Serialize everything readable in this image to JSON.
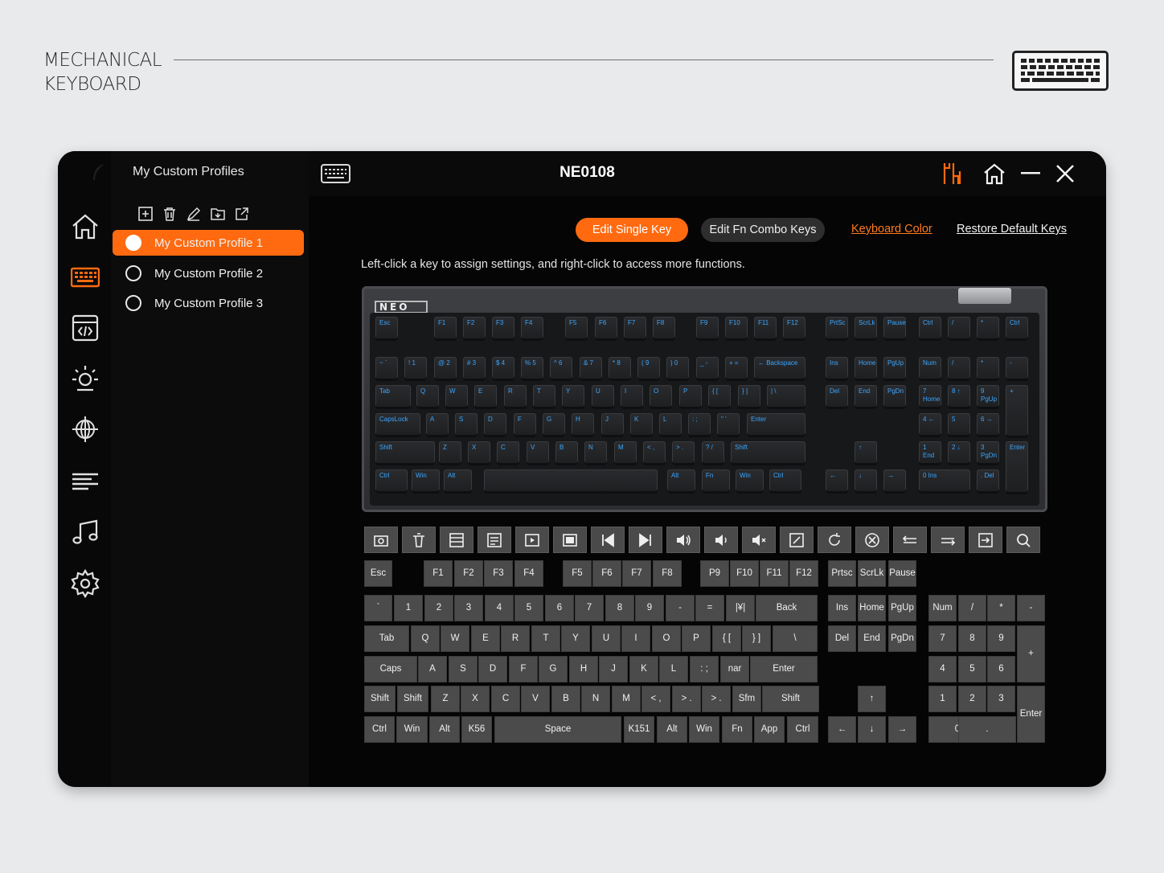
{
  "page": {
    "brand_line1": "MECHANICAL",
    "brand_line2": "KEYBOARD",
    "brand_icon": "keyboard-icon"
  },
  "app": {
    "title": "NE0108",
    "profiles_header": "My Custom Profiles",
    "accent_color": "#ff6a10",
    "window_buttons": [
      "driver-settings-icon",
      "home-icon",
      "minimize-icon",
      "close-icon"
    ]
  },
  "nav": {
    "items": [
      "home-icon",
      "keyboard-icon",
      "macro-icon",
      "lighting-icon",
      "network-icon",
      "list-icon",
      "music-icon",
      "settings-icon"
    ],
    "active": "keyboard-icon"
  },
  "profile_tools": [
    "add-icon",
    "delete-icon",
    "edit-icon",
    "import-icon",
    "export-icon"
  ],
  "profiles": [
    {
      "label": "My Custom Profile 1",
      "active": true
    },
    {
      "label": "My Custom Profile 2",
      "active": false
    },
    {
      "label": "My Custom Profile 3",
      "active": false
    }
  ],
  "toolbar": {
    "edit_single": "Edit Single Key",
    "edit_fn": "Edit Fn Combo Keys",
    "keyboard_color": "Keyboard Color",
    "restore": "Restore Default Keys"
  },
  "hint": "Left-click a key to assign settings, and right-click to access more functions.",
  "keyboard_photo": {
    "logo": "NEO",
    "rows": [
      [
        "Esc",
        "F1",
        "F2",
        "F3",
        "F4",
        "F5",
        "F6",
        "F7",
        "F8",
        "F9",
        "F10",
        "F11",
        "F12",
        "PrtSc",
        "ScrLk",
        "Pause",
        "Ctrl",
        "/",
        "*",
        "Ctrl"
      ],
      [
        "~ `",
        "! 1",
        "@ 2",
        "# 3",
        "$ 4",
        "% 5",
        "^ 6",
        "& 7",
        "* 8",
        "( 9",
        ") 0",
        "_ -",
        "+ =",
        "← Backspace",
        "Ins",
        "Home",
        "PgUp",
        "Num",
        "/",
        "*",
        "-"
      ],
      [
        "Tab",
        "Q",
        "W",
        "E",
        "R",
        "T",
        "Y",
        "U",
        "I",
        "O",
        "P",
        "{ [",
        "} ]",
        "| \\",
        "Del",
        "End",
        "PgDn",
        "7 Home",
        "8 ↑",
        "9 PgUp",
        "+"
      ],
      [
        "CapsLock",
        "A",
        "S",
        "D",
        "F",
        "G",
        "H",
        "J",
        "K",
        "L",
        ": ;",
        "\" '",
        "Enter",
        "4 ←",
        "5",
        "6 →"
      ],
      [
        "Shift",
        "Z",
        "X",
        "C",
        "V",
        "B",
        "N",
        "M",
        "< ,",
        "> .",
        "? /",
        "Shift",
        "↑",
        "1 End",
        "2 ↓",
        "3 PgDn",
        "Enter"
      ],
      [
        "Ctrl",
        "Win",
        "Alt",
        "",
        "Alt",
        "Fn",
        "Win",
        "Ctrl",
        "←",
        "↓",
        "→",
        "0 Ins",
        ". Del"
      ]
    ]
  },
  "function_buttons": [
    "screenshot-icon",
    "recycle-bin-icon",
    "calculator-icon",
    "notes-icon",
    "media-player-icon",
    "display-icon",
    "previous-track-icon",
    "next-track-icon",
    "volume-up-icon",
    "volume-down-icon",
    "mute-icon",
    "edit-box-icon",
    "refresh-icon",
    "cancel-icon",
    "tab-back-icon",
    "tab-forward-icon",
    "switch-window-icon",
    "search-icon"
  ],
  "keys": {
    "row_f": [
      "Esc",
      "F1",
      "F2",
      "F3",
      "F4",
      "F5",
      "F6",
      "F7",
      "F8",
      "P9",
      "F10",
      "F11",
      "F12",
      "Prtsc",
      "ScrLk",
      "Pause"
    ],
    "row_num": [
      "`",
      "1",
      "2",
      "3",
      "4",
      "5",
      "6",
      "7",
      "8",
      "9",
      "-",
      "=",
      "|¥|",
      "Back",
      "Ins",
      "Home",
      "PgUp",
      "Num",
      "/",
      "*",
      "-"
    ],
    "row_tab": [
      "Tab",
      "Q",
      "W",
      "E",
      "R",
      "T",
      "Y",
      "U",
      "I",
      "O",
      "P",
      "{ [",
      "} ]",
      "\\",
      "Del",
      "End",
      "PgDn",
      "7",
      "8",
      "9",
      "+"
    ],
    "row_caps": [
      "Caps",
      "A",
      "S",
      "D",
      "F",
      "G",
      "H",
      "J",
      "K",
      "L",
      ": ;",
      "nar",
      "Enter",
      "4",
      "5",
      "6"
    ],
    "row_shift": [
      "Shift",
      "Shift",
      "Z",
      "X",
      "C",
      "V",
      "B",
      "N",
      "M",
      "< ,",
      "> .",
      "> .",
      "Sfm",
      "Shift",
      "↑",
      "1",
      "2",
      "3",
      "Enter"
    ],
    "row_ctrl": [
      "Ctrl",
      "Win",
      "Alt",
      "K56",
      "Space",
      "K151",
      "Alt",
      "Win",
      "Fn",
      "App",
      "Ctrl",
      "←",
      "↓",
      "→",
      "0",
      "."
    ]
  }
}
